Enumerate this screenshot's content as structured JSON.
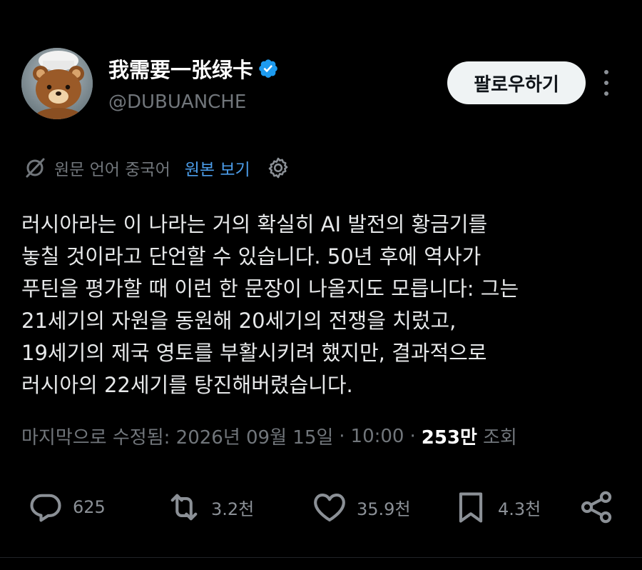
{
  "colors": {
    "background": "#000000",
    "text_primary": "#e7e9ea",
    "text_secondary": "#71767b",
    "link": "#4c9eeb",
    "verified": "#1d9bf0",
    "follow_button_bg": "#eff3f4"
  },
  "author": {
    "display_name": "我需要一张绿卡",
    "handle": "@DUBUANCHE",
    "verified": true,
    "avatar_icon": "bear-avatar"
  },
  "header": {
    "follow_label": "팔로우하기",
    "more_icon": "more-vertical-icon"
  },
  "translation": {
    "label": "원문 언어 중국어",
    "show_original": "원본 보기",
    "settings_icon": "gear-icon"
  },
  "tweet": {
    "lines": [
      "러시아라는 이 나라는 거의 확실히 AI 발전의 황금기를",
      "놓칠 것이라고 단언할 수 있습니다. 50년 후에 역사가",
      "푸틴을 평가할 때 이런 한 문장이 나올지도 모릅니다: 그는",
      "21세기의 자원을 동원해 20세기의 전쟁을 치렀고,",
      "19세기의 제국 영토를 부활시키려 했지만, 결과적으로",
      "러시아의 22세기를 탕진해버렸습니다."
    ]
  },
  "meta": {
    "edited_label": "마지막으로 수정됨: 2026년 09월 15일",
    "separator": "·",
    "time": "10:00",
    "views_count": "253만",
    "views_label": "조회"
  },
  "actions": {
    "reply_count": "625",
    "retweet_count": "3.2천",
    "like_count": "35.9천",
    "bookmark_count": "4.3천"
  }
}
